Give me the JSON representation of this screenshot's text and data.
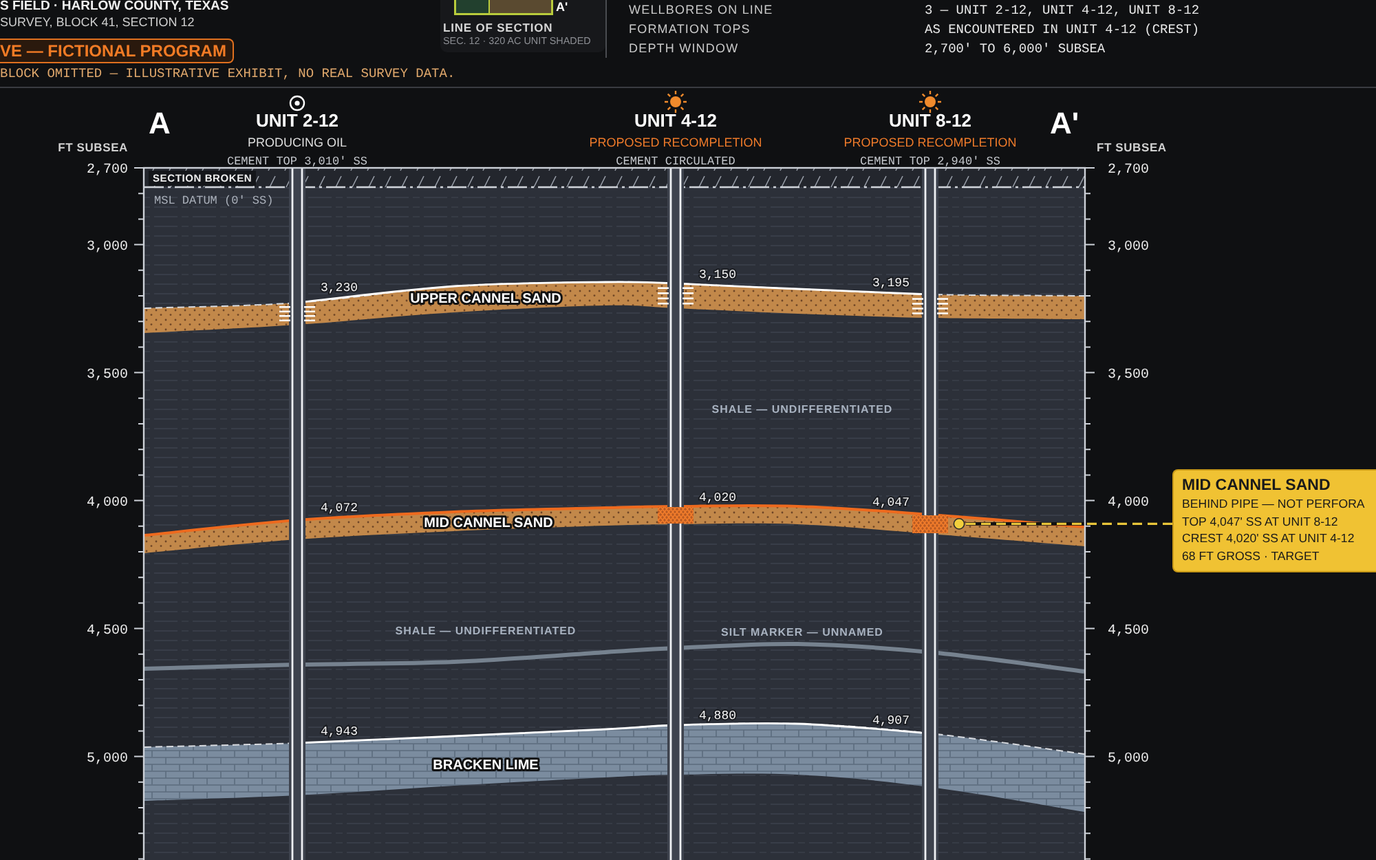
{
  "header": {
    "title": "S FIELD · HARLOW COUNTY, TEXAS",
    "subtitle": "SURVEY, BLOCK 41, SECTION 12",
    "badge": "VE — FICTIONAL PROGRAM",
    "note": "BLOCK OMITTED — ILLUSTRATIVE EXHIBIT, NO REAL SURVEY DATA."
  },
  "locator_map": {
    "end_label": "A'",
    "title": "LINE OF SECTION",
    "caption": "SEC. 12 · 320 AC UNIT SHADED"
  },
  "summary": [
    {
      "label": "WELLBORES ON LINE",
      "value": "3 — UNIT 2-12, UNIT 4-12, UNIT 8-12"
    },
    {
      "label": "FORMATION TOPS",
      "value": "AS ENCOUNTERED IN UNIT 4-12 (CREST)"
    },
    {
      "label": "DEPTH WINDOW",
      "value": "2,700' TO 6,000' SUBSEA"
    }
  ],
  "section": {
    "start_label": "A",
    "end_label": "A'",
    "left_axis": {
      "title": "FT SUBSEA",
      "ticks": [
        "2,700",
        "3,000",
        "3,500",
        "4,000",
        "4,500",
        "5,000"
      ]
    },
    "right_axis": {
      "title": "FT SUBSEA",
      "ticks": [
        "2,700",
        "3,000",
        "3,500",
        "4,000",
        "4,500",
        "5,000"
      ]
    },
    "break_label": "SECTION BROKEN",
    "datum_label": "MSL DATUM (0' SS)",
    "wells": [
      {
        "name": "UNIT 2-12",
        "kind": "producing",
        "status": "PRODUCING OIL",
        "cement": "CEMENT TOP 3,010' SS"
      },
      {
        "name": "UNIT 4-12",
        "kind": "proposed",
        "status": "PROPOSED RECOMPLETION",
        "cement": "CEMENT CIRCULATED"
      },
      {
        "name": "UNIT 8-12",
        "kind": "proposed",
        "status": "PROPOSED RECOMPLETION",
        "cement": "CEMENT TOP 2,940' SS"
      }
    ],
    "interval_labels": [
      "SHALE — UNDIFFERENTIATED",
      "SHALE — UNDIFFERENTIATED"
    ],
    "formations": [
      {
        "name": "UPPER CANNEL SAND",
        "kind": "sand",
        "picks": [
          {
            "depth": "3,230",
            "kind": "perforated"
          },
          {
            "depth": "3,150",
            "kind": "perforated"
          },
          {
            "depth": "3,195",
            "kind": "perforated"
          }
        ]
      },
      {
        "name": "MID CANNEL SAND",
        "kind": "sand",
        "picks": [
          {
            "depth": "4,072",
            "kind": "plain"
          },
          {
            "depth": "4,020",
            "kind": "behind_pipe"
          },
          {
            "depth": "4,047",
            "kind": "behind_pipe"
          }
        ],
        "callout": {
          "title": "MID CANNEL SAND",
          "lines": [
            "BEHIND PIPE — NOT PERFORA",
            "TOP 4,047' SS AT UNIT 8-12",
            "CREST 4,020' SS AT UNIT 4-12",
            "68 FT GROSS · TARGET"
          ]
        }
      },
      {
        "name": "SILT MARKER — UNNAMED",
        "kind": "marker"
      },
      {
        "name": "BRACKEN LIME",
        "kind": "lime",
        "picks": [
          {
            "depth": "4,943",
            "kind": "plain"
          },
          {
            "depth": "4,880",
            "kind": "plain"
          },
          {
            "depth": "4,907",
            "kind": "plain"
          }
        ]
      }
    ]
  }
}
